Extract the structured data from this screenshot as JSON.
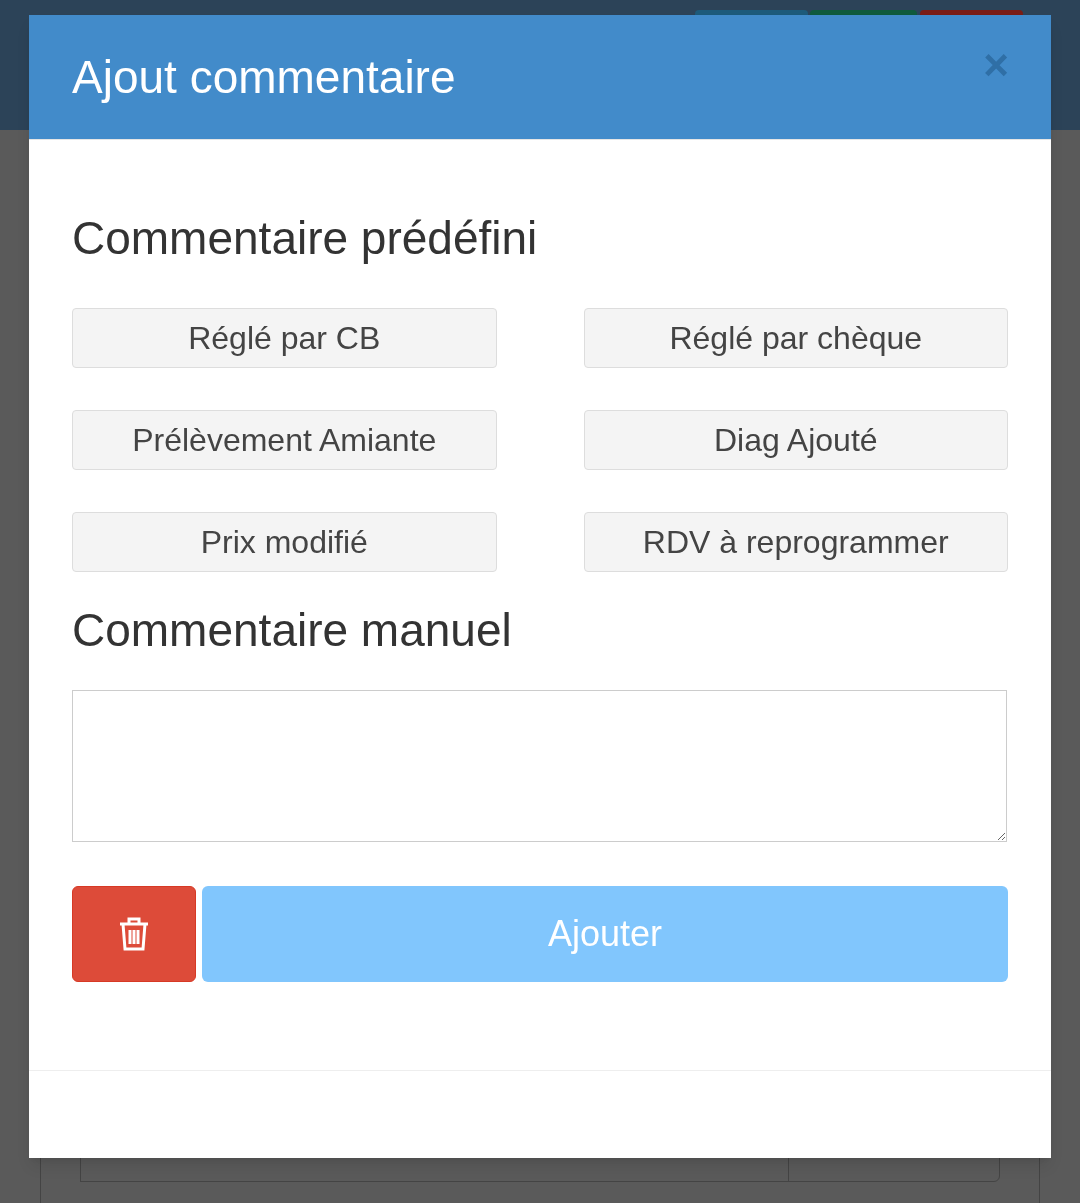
{
  "dialog": {
    "title": "Ajout commentaire",
    "close": "×"
  },
  "predefined": {
    "heading": "Commentaire prédéfini",
    "options": [
      {
        "label": "Réglé par CB"
      },
      {
        "label": "Réglé par chèque"
      },
      {
        "label": "Prélèvement Amiante"
      },
      {
        "label": "Diag Ajouté"
      },
      {
        "label": "Prix modifié"
      },
      {
        "label": "RDV à reprogrammer"
      }
    ]
  },
  "manual": {
    "heading": "Commentaire manuel"
  },
  "actions": {
    "submit": {
      "label": "Ajouter",
      "disabled": true
    }
  }
}
